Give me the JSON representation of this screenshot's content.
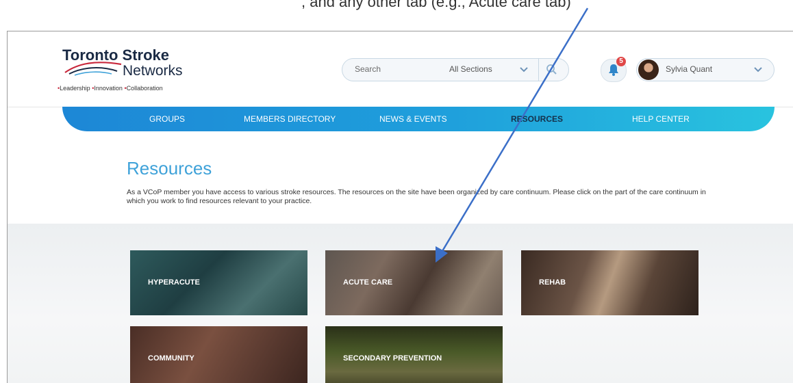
{
  "caption": ", and any other tab (e.g., Acute care tab)",
  "logo": {
    "title": "Toronto Stroke",
    "subtitle": "Networks",
    "tagline": [
      "Leadership",
      "Innovation",
      "Collaboration"
    ]
  },
  "search": {
    "placeholder": "Search",
    "section": "All Sections"
  },
  "notifications": {
    "count": "5"
  },
  "user": {
    "name": "Sylvia Quant"
  },
  "nav": {
    "items": [
      "GROUPS",
      "MEMBERS DIRECTORY",
      "NEWS & EVENTS",
      "RESOURCES",
      "HELP CENTER"
    ],
    "active": "RESOURCES"
  },
  "page": {
    "title": "Resources",
    "description": "As a VCoP member you have access to various stroke resources. The resources on the site have been organized by care continuum. Please click on the part of the care continuum in which you work to find resources relevant to your practice."
  },
  "tiles": [
    {
      "label": "HYPERACUTE"
    },
    {
      "label": "ACUTE CARE"
    },
    {
      "label": "REHAB"
    },
    {
      "label": "COMMUNITY"
    },
    {
      "label": "SECONDARY PREVENTION"
    }
  ],
  "colors": {
    "title_blue": "#3fa2d9",
    "nav_start": "#1d87d6",
    "nav_end": "#29c3df",
    "badge_red": "#e04848",
    "arrow_blue": "#3b6fc8"
  }
}
